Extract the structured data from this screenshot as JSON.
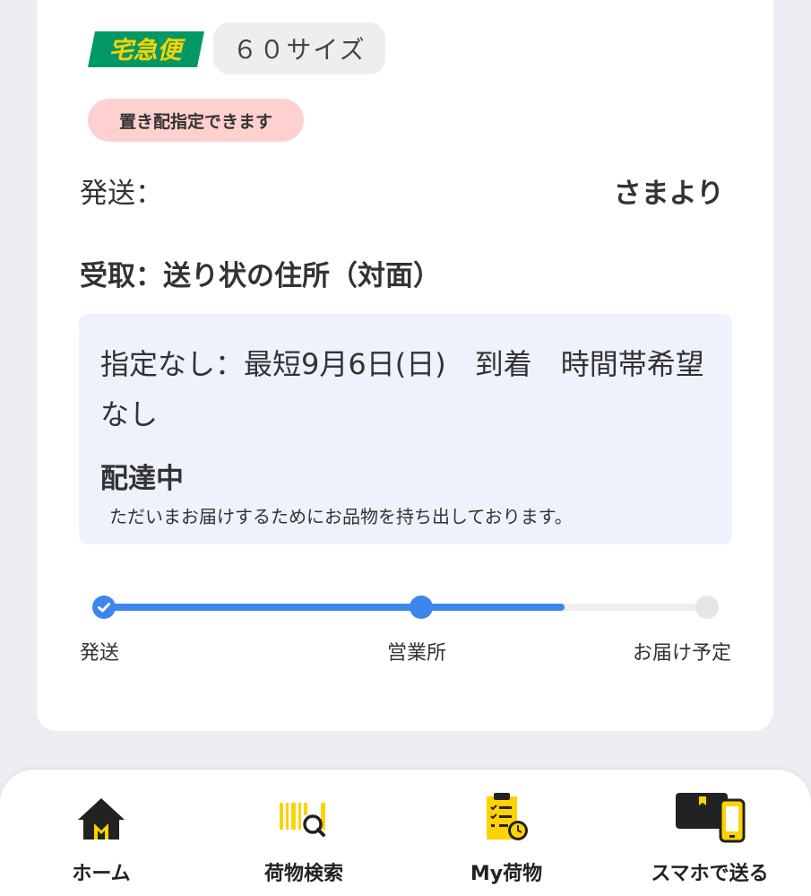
{
  "service": {
    "logo_text": "宅急便",
    "size_label": "６０サイズ",
    "okihai_label": "置き配指定できます"
  },
  "sender": {
    "label": "発送：",
    "suffix": "さまより"
  },
  "receive": {
    "text": "受取：送り状の住所（対面）"
  },
  "delivery_info": {
    "schedule": "指定なし：最短9月6日(日)　到着　時間帯希望なし",
    "status_title": "配達中",
    "status_desc": "ただいまお届けするためにお品物を持ち出しております。"
  },
  "progress": {
    "steps": [
      {
        "label": "発送",
        "state": "done"
      },
      {
        "label": "営業所",
        "state": "current"
      },
      {
        "label": "お届け予定",
        "state": "pending"
      }
    ],
    "fill_fraction": 0.765
  },
  "bottom_nav": {
    "items": [
      {
        "label": "ホーム",
        "icon": "home-icon"
      },
      {
        "label": "荷物検索",
        "icon": "barcode-search-icon"
      },
      {
        "label": "My荷物",
        "icon": "package-list-icon"
      },
      {
        "label": "スマホで送る",
        "icon": "phone-send-icon"
      }
    ]
  },
  "colors": {
    "accent_blue": "#3d86f0",
    "brand_green": "#009966",
    "brand_yellow": "#ffd200",
    "badge_pink": "#ffd0d0",
    "info_bg": "#eef2fd"
  }
}
